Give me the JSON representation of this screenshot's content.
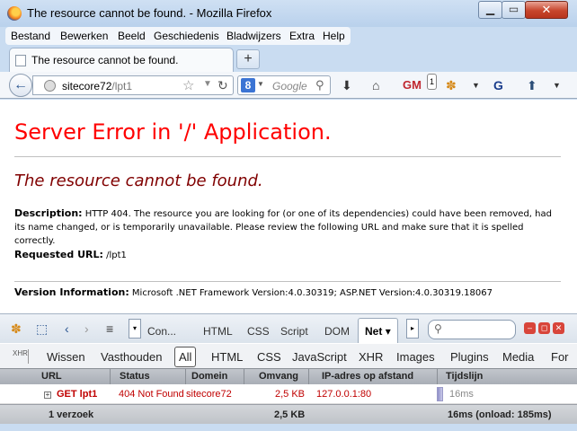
{
  "window": {
    "title": "The resource cannot be found. - Mozilla Firefox",
    "min_glyph": "▁",
    "max_glyph": "▭",
    "close_glyph": "✕"
  },
  "menubar": {
    "items": [
      "Bestand",
      "Bewerken",
      "Beeld",
      "Geschiedenis",
      "Bladwijzers",
      "Extra",
      "Help"
    ]
  },
  "tabs": {
    "active_label": "The resource cannot be found.",
    "new_tab_glyph": "+"
  },
  "navbar": {
    "url_host": "sitecore72",
    "url_path": "/lpt1",
    "search_engine_letter": "8",
    "search_placeholder": "Google",
    "badge_count": "1"
  },
  "page": {
    "heading": "Server Error in '/' Application.",
    "subheading": "The resource cannot be found.",
    "description_label": "Description:",
    "description_text": "HTTP 404. The resource you are looking for (or one of its dependencies) could have been removed, had its name changed, or is temporarily unavailable.  Please review the following URL and make sure that it is spelled correctly.",
    "requested_url_label": "Requested URL:",
    "requested_url_value": "/lpt1",
    "version_label": "Version Information:",
    "version_text": "Microsoft .NET Framework Version:4.0.30319; ASP.NET Version:4.0.30319.18067"
  },
  "firebug": {
    "tabs": [
      "Con...",
      "HTML",
      "CSS",
      "Script",
      "DOM",
      "Net"
    ],
    "active_tab": "Net",
    "active_tab_arrow": "▾",
    "filter_buttons": [
      "Wissen",
      "Vasthouden",
      "All",
      "HTML",
      "CSS",
      "JavaScript",
      "XHR",
      "Images",
      "Plugins",
      "Media",
      "For"
    ],
    "active_filter": "All",
    "clear_icon_text": "XHR",
    "columns": [
      "URL",
      "Status",
      "Domein",
      "Omvang",
      "IP-adres op afstand",
      "Tijdslijn"
    ],
    "rows": [
      {
        "url": "GET lpt1",
        "status": "404 Not Found",
        "domain": "sitecore72",
        "size": "2,5 KB",
        "remote_ip": "127.0.0.1:80",
        "timeline": "16ms"
      }
    ],
    "footer": {
      "requests": "1 verzoek",
      "total_size": "2,5 KB",
      "timing": "16ms (onload: 185ms)"
    },
    "status_colors": {
      "error": "#c00000"
    }
  }
}
